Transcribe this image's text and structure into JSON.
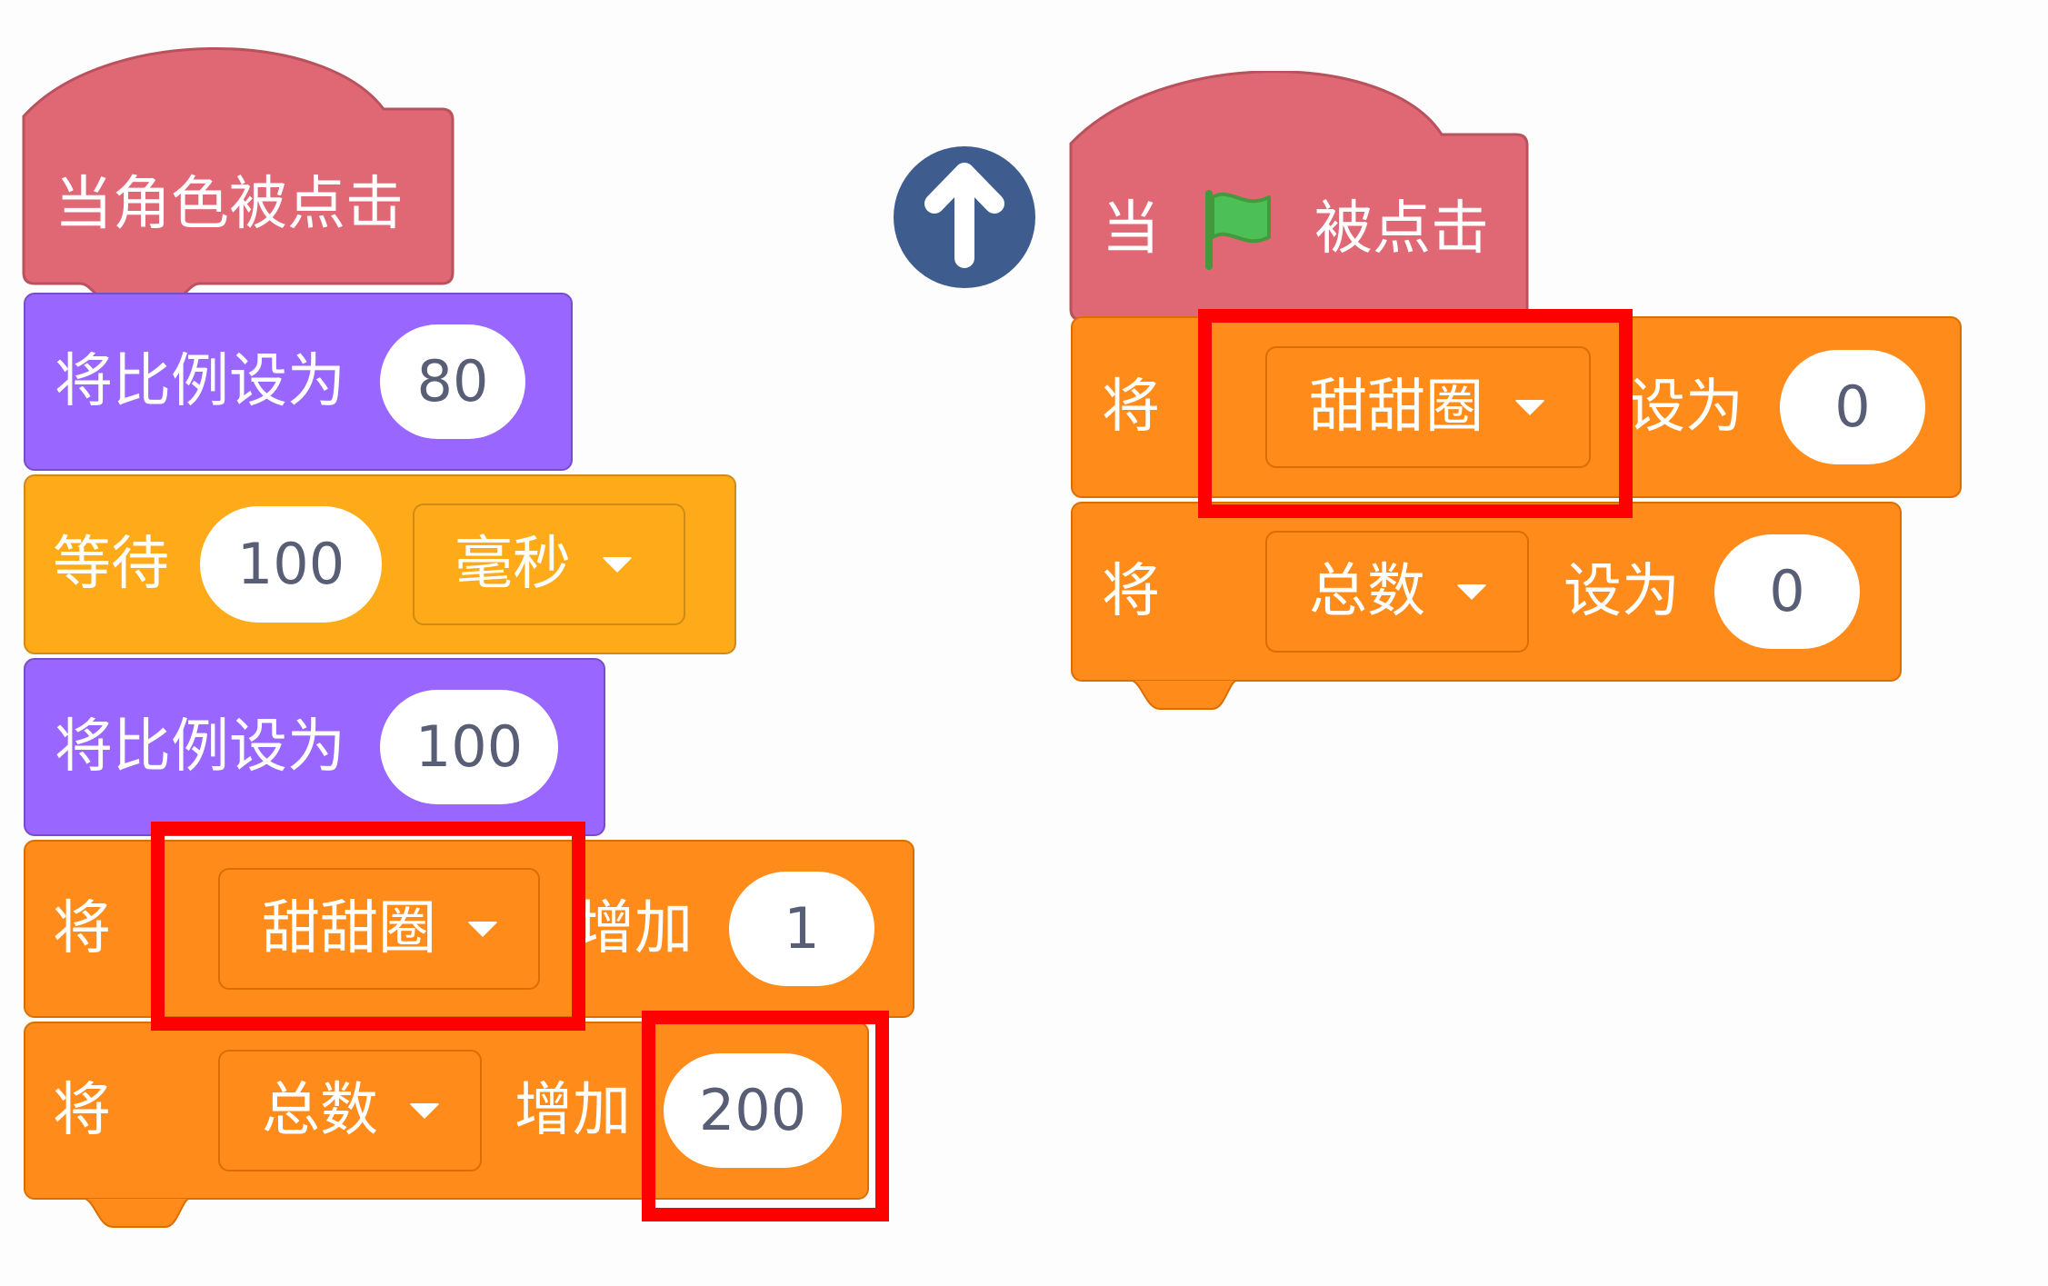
{
  "colors": {
    "event": "#e06875",
    "looks": "#9966ff",
    "control": "#ffab19",
    "variables": "#ff8c1a",
    "highlight": "#ff0000",
    "arrow_circle": "#3f5c8f",
    "flag": "#4cbf56"
  },
  "left_script": {
    "hat": {
      "label": "当角色被点击"
    },
    "set_size_1": {
      "label": "将比例设为",
      "value": "80"
    },
    "wait": {
      "label": "等待",
      "value": "100",
      "unit": "毫秒"
    },
    "set_size_2": {
      "label": "将比例设为",
      "value": "100"
    },
    "change_donut": {
      "prefix": "将",
      "variable": "甜甜圈",
      "action": "增加",
      "value": "1"
    },
    "change_total": {
      "prefix": "将",
      "variable": "总数",
      "action": "增加",
      "value": "200"
    }
  },
  "right_script": {
    "hat": {
      "prefix": "当",
      "flag_icon": "green-flag-icon",
      "suffix": "被点击"
    },
    "set_donut": {
      "prefix": "将",
      "variable": "甜甜圈",
      "action": "设为",
      "value": "0"
    },
    "set_total": {
      "prefix": "将",
      "variable": "总数",
      "action": "设为",
      "value": "0"
    }
  },
  "middle_icon": "arrow-up-circle-icon"
}
